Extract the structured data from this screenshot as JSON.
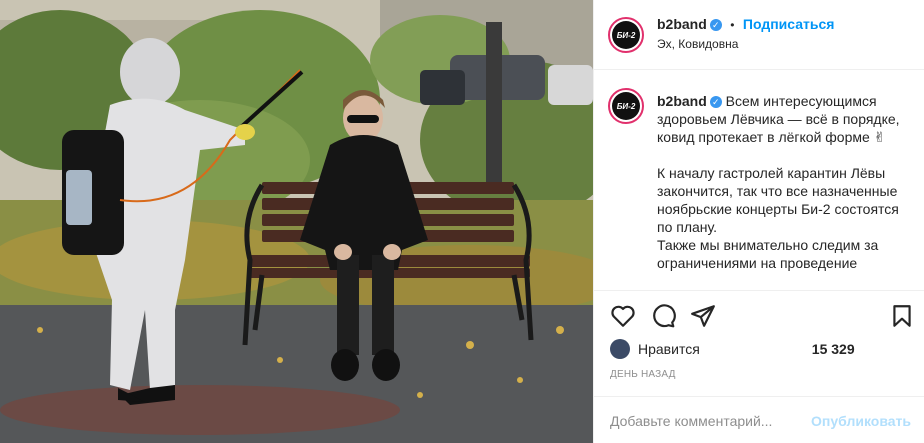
{
  "header": {
    "username": "b2band",
    "separator": "•",
    "follow_label": "Подписаться",
    "location": "Эх, Ковидовна",
    "avatar_text": "БИ-2"
  },
  "caption": {
    "username": "b2band",
    "avatar_text": "БИ-2",
    "line1": "Всем интересующимся здоровьем Лёвчика — всё в порядке, ковид протекает в лёгкой форме ✌",
    "line2": "К началу гастролей карантин Лёвы закончится, так что все назначенные ноябрьские концерты Би-2 состоятся по плану.",
    "line3": "Также мы внимательно следим за ограничениями на проведение"
  },
  "actions": {
    "like_icon": "heart-icon",
    "comment_icon": "comment-icon",
    "share_icon": "share-icon",
    "save_icon": "bookmark-icon"
  },
  "likes": {
    "label": "Нравится",
    "count": "15 329"
  },
  "timestamp": "ДЕНЬ НАЗАД",
  "comment": {
    "placeholder": "Добавьте комментарий...",
    "post_label": "Опубликовать"
  },
  "colors": {
    "accent": "#0095f6",
    "story_ring": "#e1306c",
    "verified": "#3897f0",
    "post_disabled": "#b2dffc"
  }
}
